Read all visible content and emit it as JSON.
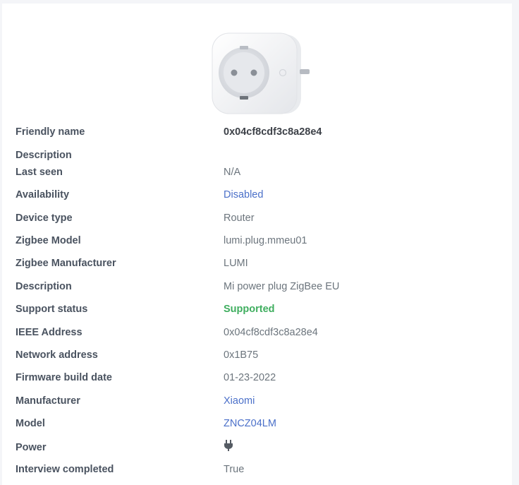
{
  "device": {
    "image_icon": "smart-plug-image"
  },
  "details": {
    "friendly_name": {
      "label": "Friendly name",
      "value": "0x04cf8cdf3c8a28e4"
    },
    "description_empty": {
      "label": "Description",
      "value": ""
    },
    "last_seen": {
      "label": "Last seen",
      "value": "N/A"
    },
    "availability": {
      "label": "Availability",
      "value": "Disabled"
    },
    "device_type": {
      "label": "Device type",
      "value": "Router"
    },
    "zigbee_model": {
      "label": "Zigbee Model",
      "value": "lumi.plug.mmeu01"
    },
    "zigbee_manufacturer": {
      "label": "Zigbee Manufacturer",
      "value": "LUMI"
    },
    "description": {
      "label": "Description",
      "value": "Mi power plug ZigBee EU"
    },
    "support_status": {
      "label": "Support status",
      "value": "Supported"
    },
    "ieee_address": {
      "label": "IEEE Address",
      "value": "0x04cf8cdf3c8a28e4"
    },
    "network_address": {
      "label": "Network address",
      "value": "0x1B75"
    },
    "firmware_build_date": {
      "label": "Firmware build date",
      "value": "01-23-2022"
    },
    "manufacturer": {
      "label": "Manufacturer",
      "value": "Xiaomi"
    },
    "model": {
      "label": "Model",
      "value": "ZNCZ04LM"
    },
    "power": {
      "label": "Power",
      "icon": "power-plug-icon"
    },
    "interview_completed": {
      "label": "Interview completed",
      "value": "True"
    }
  },
  "colors": {
    "link": "#4b70c9",
    "supported": "#3fae5f"
  }
}
